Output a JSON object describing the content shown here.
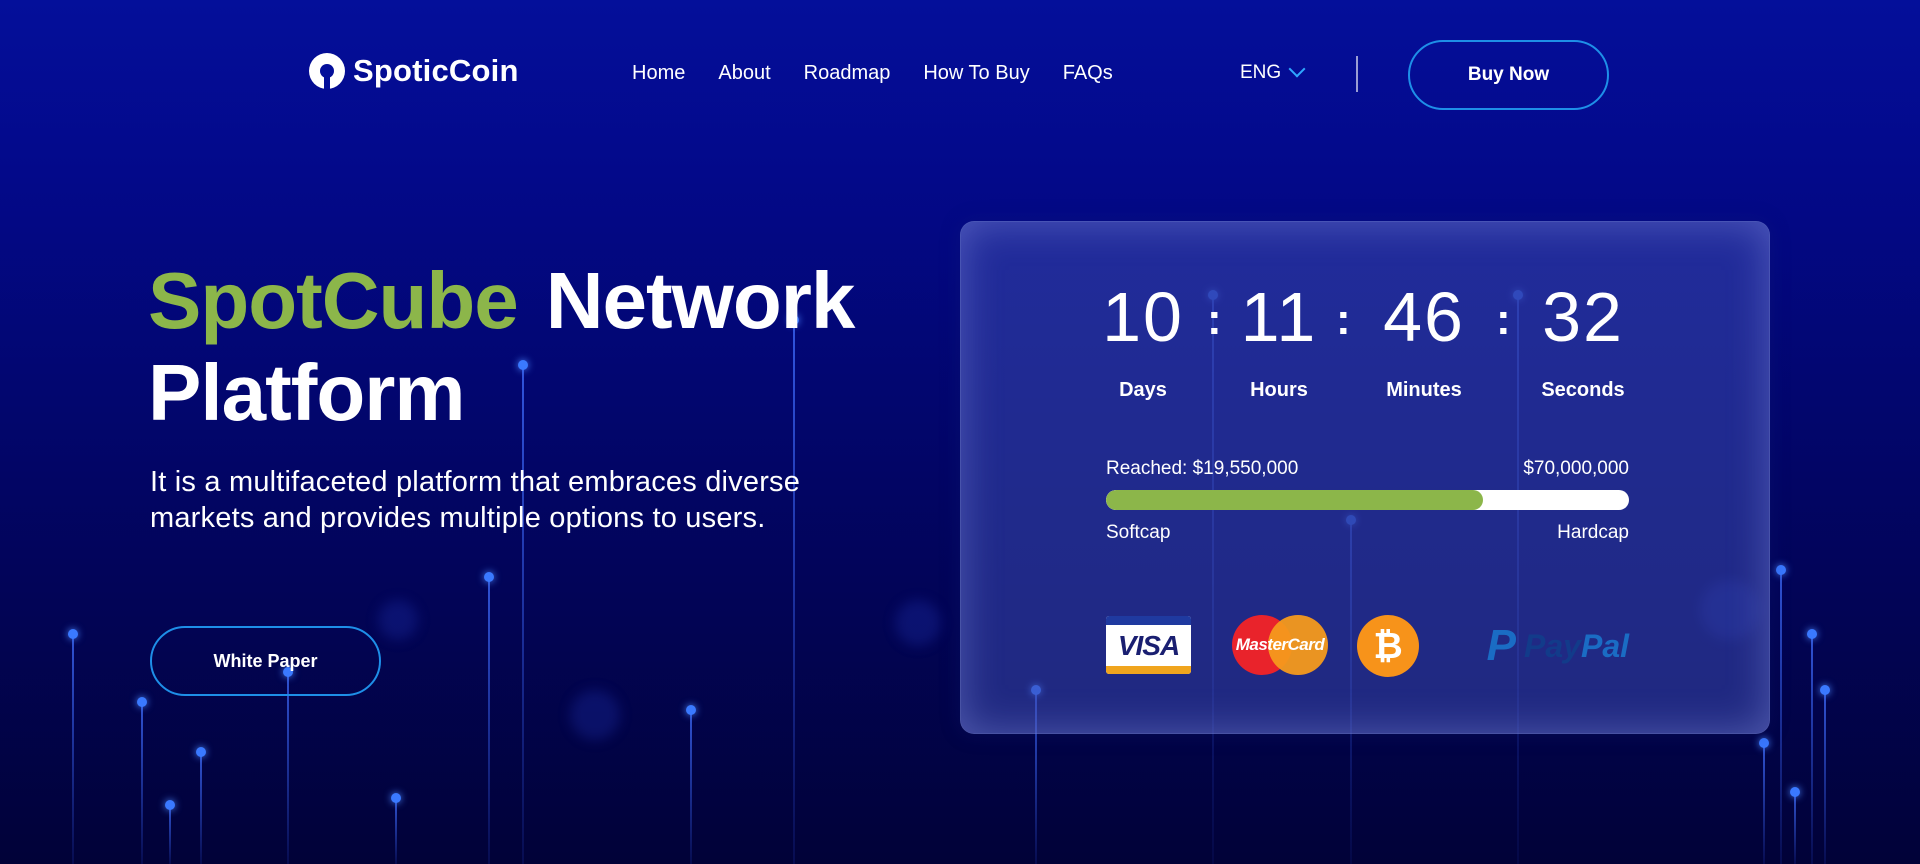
{
  "brand": {
    "name": "SpoticCoin"
  },
  "nav": {
    "items": [
      {
        "label": "Home"
      },
      {
        "label": "About"
      },
      {
        "label": "Roadmap"
      },
      {
        "label": "How To Buy"
      },
      {
        "label": "FAQs"
      }
    ]
  },
  "language": {
    "selected": "ENG"
  },
  "header": {
    "buy_now_label": "Buy Now"
  },
  "hero": {
    "title_accent": "SpotCube",
    "title_rest": "Network Platform",
    "description": "It is a multifaceted platform that embraces diverse markets and provides multiple options to users.",
    "white_paper_label": "White Paper"
  },
  "countdown": {
    "units": [
      {
        "value": "10",
        "label": "Days"
      },
      {
        "value": "11",
        "label": "Hours"
      },
      {
        "value": "46",
        "label": "Minutes"
      },
      {
        "value": "32",
        "label": "Seconds"
      }
    ],
    "separator": ":"
  },
  "fundraising": {
    "reached_label": "Reached: $19,550,000",
    "target_label": "$70,000,000",
    "progress_fraction": 0.72,
    "softcap_label": "Softcap",
    "hardcap_label": "Hardcap"
  },
  "payments": {
    "visa": "VISA",
    "mastercard": "MasterCard",
    "bitcoin": "₿",
    "paypal_mark": "P",
    "paypal_word_a": "Pay",
    "paypal_word_b": "Pal"
  },
  "colors": {
    "accent_green": "#8cb64a",
    "button_border": "#1e8fe8",
    "background_top": "#040f9a",
    "background_bottom": "#010238"
  }
}
